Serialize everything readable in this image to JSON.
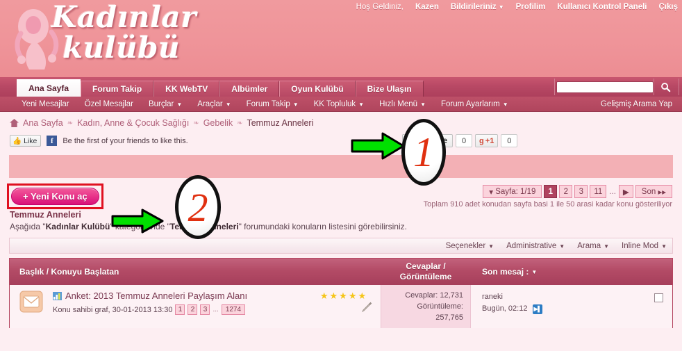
{
  "header": {
    "logo_line1": "Kadınlar",
    "logo_line2": "kulübü",
    "topnav": [
      {
        "label": "Hoş Geldiniz,",
        "bold": false,
        "caret": false
      },
      {
        "label": "Kazen",
        "bold": true,
        "caret": false
      },
      {
        "label": "Bildirileriniz",
        "bold": true,
        "caret": true
      },
      {
        "label": "Profilim",
        "bold": true,
        "caret": false
      },
      {
        "label": "Kullanıcı Kontrol Paneli",
        "bold": true,
        "caret": false
      },
      {
        "label": "Çıkış",
        "bold": true,
        "caret": false
      }
    ]
  },
  "tabs": [
    {
      "label": "Ana Sayfa",
      "active": true
    },
    {
      "label": "Forum Takip",
      "active": false
    },
    {
      "label": "KK WebTV",
      "active": false
    },
    {
      "label": "Albümler",
      "active": false
    },
    {
      "label": "Oyun Kulübü",
      "active": false
    },
    {
      "label": "Bize Ulaşın",
      "active": false
    }
  ],
  "search": {
    "value": "",
    "placeholder": "",
    "icon": "search-icon",
    "advanced_label": "Gelişmiş Arama Yap"
  },
  "subnav": [
    {
      "label": "Yeni Mesajlar",
      "caret": false
    },
    {
      "label": "Özel Mesajlar",
      "caret": false
    },
    {
      "label": "Burçlar",
      "caret": true
    },
    {
      "label": "Araçlar",
      "caret": true
    },
    {
      "label": "Forum Takip",
      "caret": true
    },
    {
      "label": "KK Topluluk",
      "caret": true
    },
    {
      "label": "Hızlı Menü",
      "caret": true
    },
    {
      "label": "Forum Ayarlarım",
      "caret": true
    }
  ],
  "breadcrumb": [
    {
      "label": "Ana Sayfa",
      "current": false
    },
    {
      "label": "Kadın, Anne & Çocuk Sağlığı",
      "current": false
    },
    {
      "label": "Gebelik",
      "current": false
    },
    {
      "label": "Temmuz Anneleri",
      "current": true
    }
  ],
  "social": {
    "like_label": "Like",
    "fb_text": "Be the first of your friends to like this.",
    "tweet_label": "Tweetle",
    "tweet_count": "0",
    "gplus_label": "+1",
    "gplus_count": "0"
  },
  "actions": {
    "new_topic_label": "+ Yeni Konu aç"
  },
  "pager": {
    "page_label": "Sayfa: 1/19",
    "pages": [
      {
        "label": "1",
        "selected": true
      },
      {
        "label": "2",
        "selected": false
      },
      {
        "label": "3",
        "selected": false
      },
      {
        "label": "11",
        "selected": false
      }
    ],
    "dots": "...",
    "next_label": "▶",
    "last_label": "Son",
    "note": "Toplam 910 adet konudan sayfa basi 1 ile 50 arasi kadar konu gösteriliyor"
  },
  "forum": {
    "title": "Temmuz Anneleri",
    "desc_pre": "Aşağıda \"",
    "desc_b1": "Kadınlar Kulübü",
    "desc_mid": "\" kategorisinde \"",
    "desc_b2": "Temmuz Anneleri",
    "desc_post": "\" forumundaki konuların listesini görebilirsiniz."
  },
  "options_bar": [
    {
      "label": "Seçenekler",
      "caret": true
    },
    {
      "label": "Administrative",
      "caret": true
    },
    {
      "label": "Arama",
      "caret": true
    },
    {
      "label": "Inline Mod",
      "caret": true
    }
  ],
  "table": {
    "headers": {
      "title": "Başlık / Konuyu Başlatan",
      "counts_line1": "Cevaplar /",
      "counts_line2": "Görüntüleme",
      "last_post": "Son mesaj :"
    },
    "rows": [
      {
        "icon": "envelope-icon",
        "prefix_icon": "poll-icon",
        "title": "Anket: 2013 Temmuz Anneleri Paylaşım Alanı",
        "starter_text": "Konu sahibi graf, 30-01-2013 13:30",
        "mini_pages": [
          "1",
          "2",
          "3"
        ],
        "mini_dots": "...",
        "mini_last": "1274",
        "stars": 5,
        "replies_label": "Cevaplar: 12,731",
        "views_label": "Görüntüleme:",
        "views_value": "257,765",
        "last_user": "raneki",
        "last_time": "Bugün, 02:12",
        "last_badge": "go-icon",
        "checkbox": false
      }
    ]
  },
  "annotations": [
    {
      "number": "1",
      "arrow": "green-arrow-right"
    },
    {
      "number": "2",
      "arrow": "green-arrow-right"
    }
  ],
  "colors": {
    "header_pink": "#ef9499",
    "nav_rose": "#b74864",
    "page_bg": "#fdeef2",
    "banner_pink": "#f3b0b5",
    "accent_magenta": "#e8348a",
    "anno_red": "#e03010",
    "anno_green": "#00e000"
  }
}
